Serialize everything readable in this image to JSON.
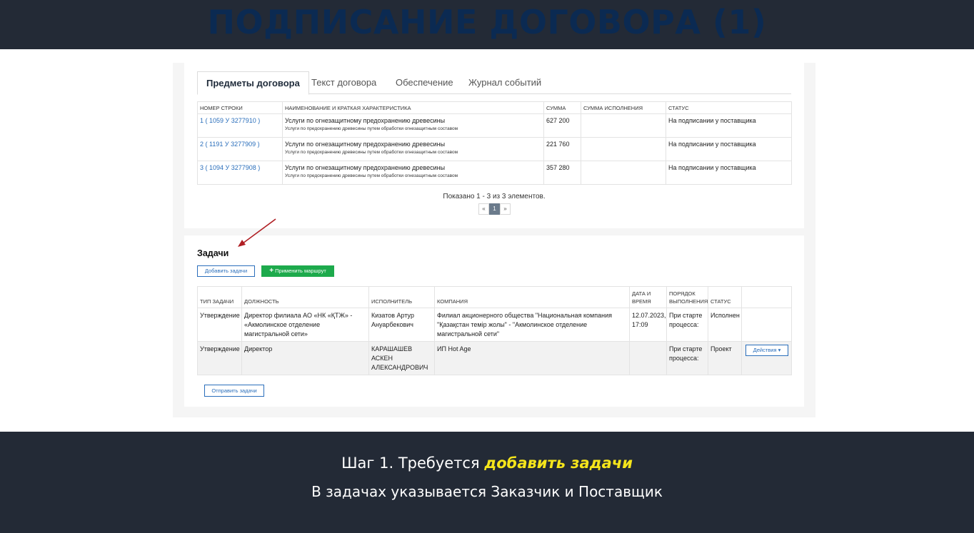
{
  "banner": {
    "title": "ПОДПИСАНИЕ ДОГОВОРА (1)"
  },
  "tabs": [
    {
      "label": "Предметы договора",
      "active": true
    },
    {
      "label": "Текст договора"
    },
    {
      "label": "Обеспечение"
    },
    {
      "label": "Журнал событий"
    }
  ],
  "items_table": {
    "headers": [
      "НОМЕР СТРОКИ",
      "НАИМЕНОВАНИЕ И КРАТКАЯ ХАРАКТЕРИСТИКА",
      "СУММА",
      "СУММА ИСПОЛНЕНИЯ",
      "СТАТУС"
    ],
    "rows": [
      {
        "number": "1 ( 1059 У 3277910 )",
        "name": "Услуги по огнезащитному предохранению древесины",
        "desc": "Услуги по предохранению древесины путем обработки огнезащитным составом",
        "sum": "627 200",
        "exec_sum": "",
        "status": "На подписании у поставщика"
      },
      {
        "number": "2 ( 1191 У 3277909 )",
        "name": "Услуги по огнезащитному предохранению древесины",
        "desc": "Услуги по предохранению древесины путем обработки огнезащитным составом",
        "sum": "221 760",
        "exec_sum": "",
        "status": "На подписании у поставщика"
      },
      {
        "number": "3 ( 1094 У 3277908 )",
        "name": "Услуги по огнезащитному предохранению древесины",
        "desc": "Услуги по предохранению древесины путем обработки огнезащитным составом",
        "sum": "357 280",
        "exec_sum": "",
        "status": "На подписании у поставщика"
      }
    ]
  },
  "pagination": {
    "summary": "Показано 1 - 3 из 3 элементов.",
    "prev": "«",
    "current": "1",
    "next": "»"
  },
  "tasks": {
    "title": "Задачи",
    "add_button": "Добавить задачи",
    "route_icon": "+",
    "route_button": "Применить маршрут",
    "send_button": "Отправить задачи",
    "headers": [
      "ТИП ЗАДАЧИ",
      "ДОЛЖНОСТЬ",
      "ИСПОЛНИТЕЛЬ",
      "КОМПАНИЯ",
      "ДАТА И ВРЕМЯ",
      "ПОРЯДОК ВЫПОЛНЕНИЯ",
      "СТАТУС",
      ""
    ],
    "rows": [
      {
        "type": "Утверждение",
        "position": "Директор филиала АО «НК «ҚТЖ» - «Акмолинское отделение магистральной сети»",
        "executor": "Кизатов Артур Ануарбекович",
        "company": "Филиал акционерного общества \"Национальная компания \"Қазақстан темір жолы\" - \"Акмолинское отделение магистральной сети\"",
        "datetime": "12.07.2023, 17:09",
        "order": "При старте процесса:",
        "status": "Исполнен",
        "action": ""
      },
      {
        "type": "Утверждение",
        "position": "Директор",
        "executor": "КАРАШАШЕВ АСКЕН АЛЕКСАНДРОВИЧ",
        "company": "ИП Hot Age",
        "datetime": "",
        "order": "При старте процесса:",
        "status": "Проект",
        "action": "Действия ▾"
      }
    ]
  },
  "caption": {
    "line1_prefix": "Шаг 1. Требуется ",
    "line1_highlight": "добавить задачи",
    "line2": "В задачах указывается Заказчик и Поставщик"
  },
  "colors": {
    "background": "#232a36",
    "title": "#0b2a52",
    "link": "#2a6ebb",
    "route_button": "#1daa4c",
    "highlight": "#f5e51b",
    "arrow": "#b01f24"
  },
  "icons": {
    "annotation": "arrow-icon"
  }
}
